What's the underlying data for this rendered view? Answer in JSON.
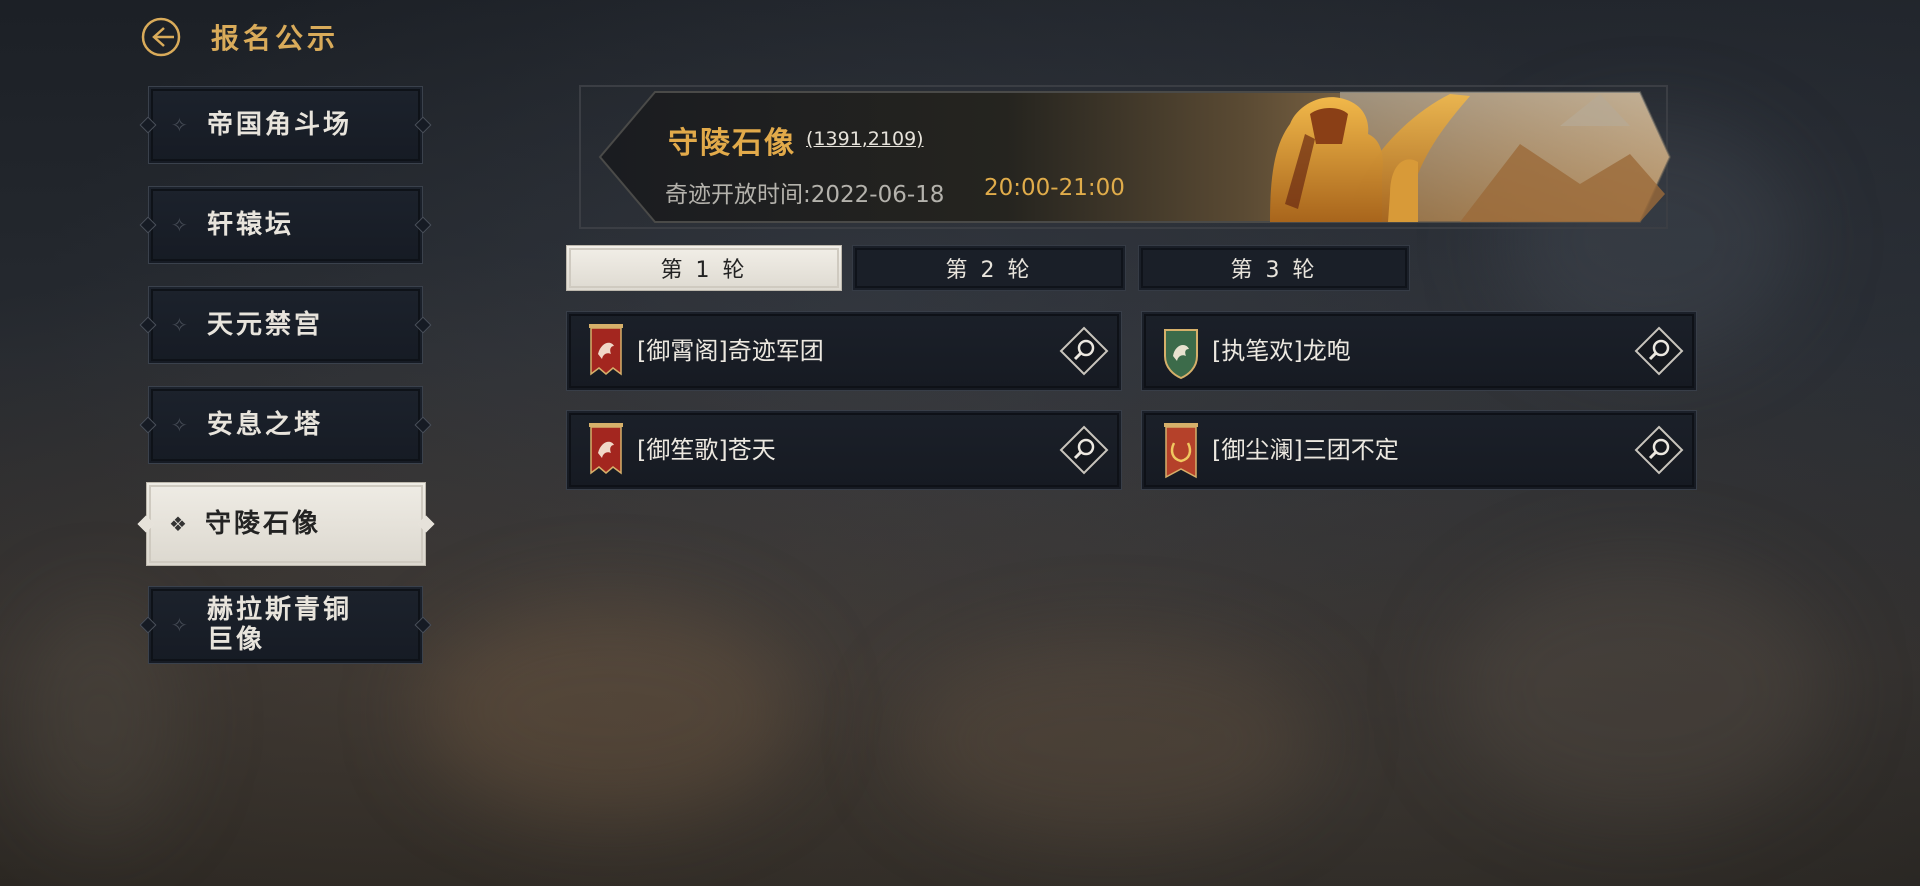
{
  "header": {
    "title": "报名公示",
    "back_icon": "back-arrow-icon"
  },
  "sidebar": {
    "items": [
      {
        "label": "帝国角斗场",
        "active": false
      },
      {
        "label": "轩辕坛",
        "active": false
      },
      {
        "label": "天元禁宫",
        "active": false
      },
      {
        "label": "安息之塔",
        "active": false
      },
      {
        "label": "守陵石像",
        "active": true
      },
      {
        "label": "赫拉斯青铜巨像",
        "active": false
      }
    ]
  },
  "banner": {
    "title": "守陵石像",
    "coords": "(1391,2109)",
    "time_label": "奇迹开放时间:2022-06-18",
    "time_range": "20:00-21:00"
  },
  "tabs": [
    {
      "label": "第 1 轮",
      "active": true
    },
    {
      "label": "第 2 轮",
      "active": false
    },
    {
      "label": "第 3 轮",
      "active": false
    }
  ],
  "guilds": [
    {
      "name": "[御霄阁]奇迹军团",
      "flag": "red-dragon-banner-icon",
      "flag_color": "#a3261f"
    },
    {
      "name": "[执笔欢]龙咆",
      "flag": "green-dragon-shield-icon",
      "flag_color": "#3c6b4a"
    },
    {
      "name": "[御笙歌]苍天",
      "flag": "red-dragon-banner-icon",
      "flag_color": "#a3261f"
    },
    {
      "name": "[御尘澜]三团不定",
      "flag": "laurel-wreath-banner-icon",
      "flag_color": "#b5412a"
    }
  ],
  "colors": {
    "accent_gold": "#e2aa4a",
    "panel": "#1b2029",
    "active_tab": "#efece5"
  }
}
